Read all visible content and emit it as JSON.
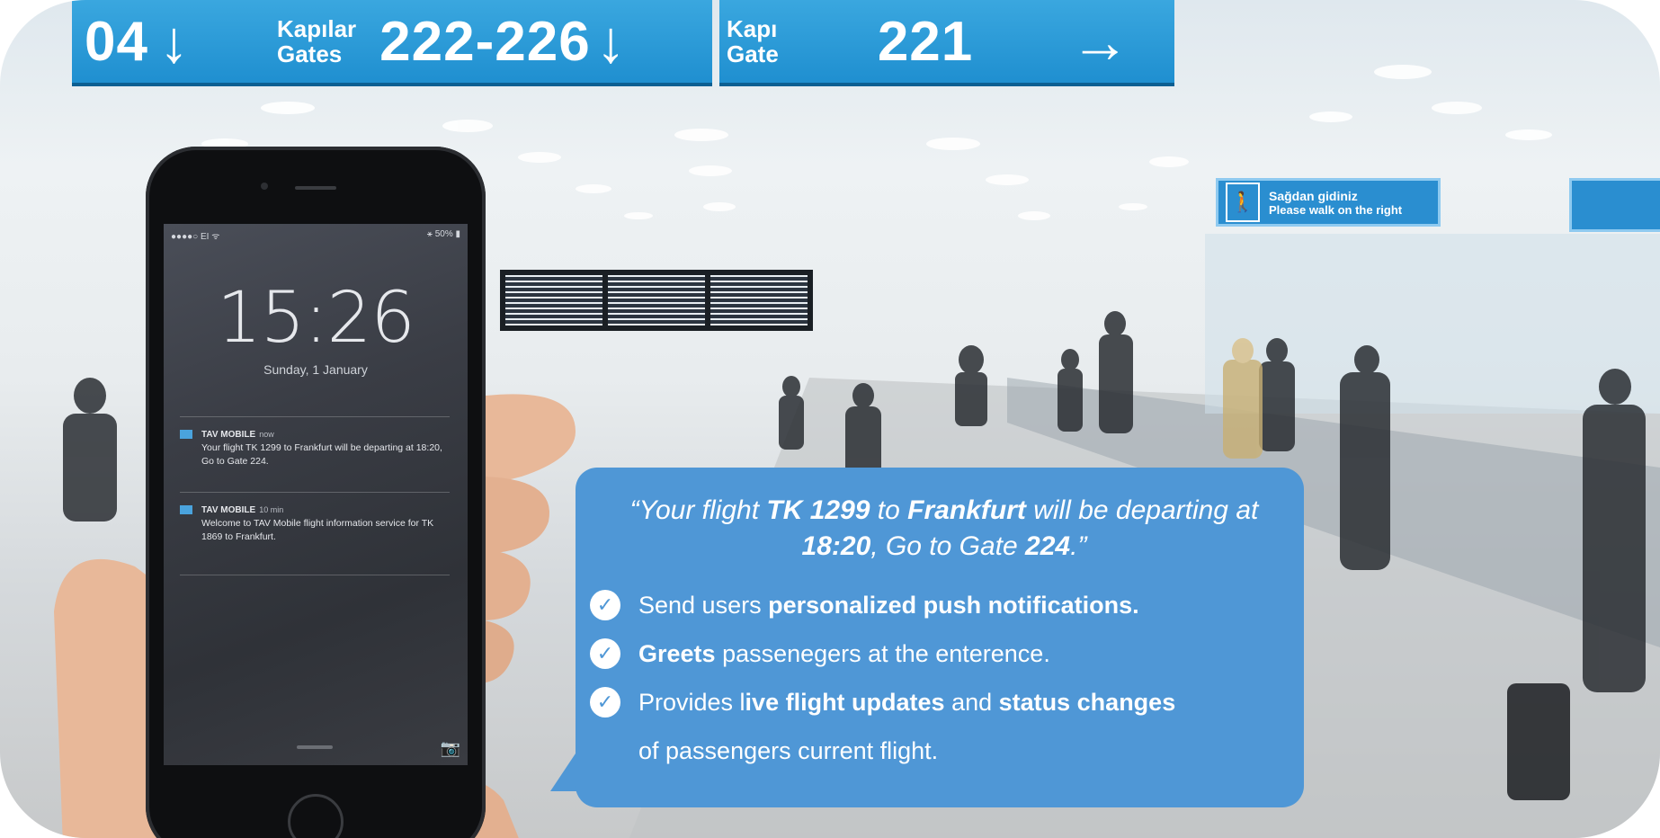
{
  "signs": {
    "left": {
      "number": "04",
      "arrow": "↓"
    },
    "middle": {
      "label_tr": "Kapılar",
      "label_en": "Gates",
      "number": "222-226",
      "arrow": "↓"
    },
    "right": {
      "label_tr": "Kapı",
      "label_en": "Gate",
      "number": "221",
      "arrow": "→"
    },
    "walk": {
      "line1": "Sağdan gidiniz",
      "line2": "Please walk on the right"
    }
  },
  "phone": {
    "status_left": "●●●●○ EI ᯤ",
    "status_right": "⚹ 50% ▮",
    "time": "15:26",
    "date": "Sunday, 1 January",
    "notifications": [
      {
        "app": "TAV MOBILE",
        "when": "now",
        "body": "Your flight TK 1299 to Frankfurt will be departing at 18:20, Go to Gate 224."
      },
      {
        "app": "TAV MOBILE",
        "when": "10 min",
        "body": "Welcome to TAV Mobile flight information service for TK 1869 to Frankfurt."
      }
    ]
  },
  "bubble": {
    "quote_parts": [
      "“Your  flight ",
      "TK 1299",
      " to ",
      "Frankfurt",
      " will be departing at ",
      "18:20",
      ", Go to Gate ",
      "224",
      ".”"
    ],
    "features": [
      {
        "plain_before": "Send users ",
        "bold": "personalized push notifications.",
        "plain_after": ""
      },
      {
        "plain_before": "",
        "bold": "Greets",
        "plain_after": " passenegers  at the enterence."
      },
      {
        "plain_before": "Provides l",
        "bold": "ive flight updates",
        "plain_after": " and ",
        "bold2": "status changes"
      }
    ],
    "continuation": "of passengers current flight."
  },
  "icons": {
    "check": "check-circle-icon",
    "camera": "camera-icon",
    "walk": "person-walking-icon"
  },
  "colors": {
    "sign_blue": "#2a96d6",
    "bubble_blue": "#4f97d6"
  }
}
